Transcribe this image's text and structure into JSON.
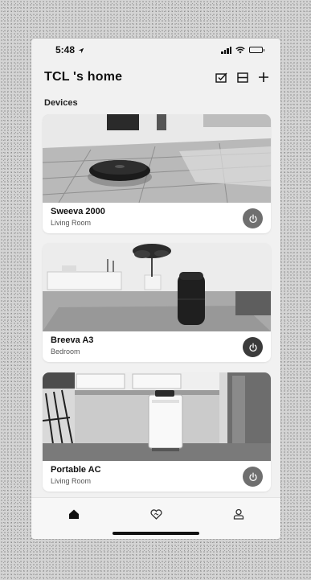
{
  "status_bar": {
    "time": "5:48"
  },
  "header": {
    "title": "TCL 's home"
  },
  "devices_label": "Devices",
  "devices": [
    {
      "name": "Sweeva 2000",
      "room": "Living Room",
      "power_icon": "power-icon"
    },
    {
      "name": "Breeva A3",
      "room": "Bedroom",
      "power_icon": "power-icon"
    },
    {
      "name": "Portable AC",
      "room": "Living Room",
      "power_icon": "power-icon"
    }
  ],
  "tab_bar": {
    "tabs": [
      "home-icon",
      "heart-icon",
      "profile-icon"
    ],
    "selected": "home-icon"
  },
  "colors": {
    "background": "#f1f1f1",
    "card": "#ffffff",
    "power_button": "#6f6f6f"
  }
}
